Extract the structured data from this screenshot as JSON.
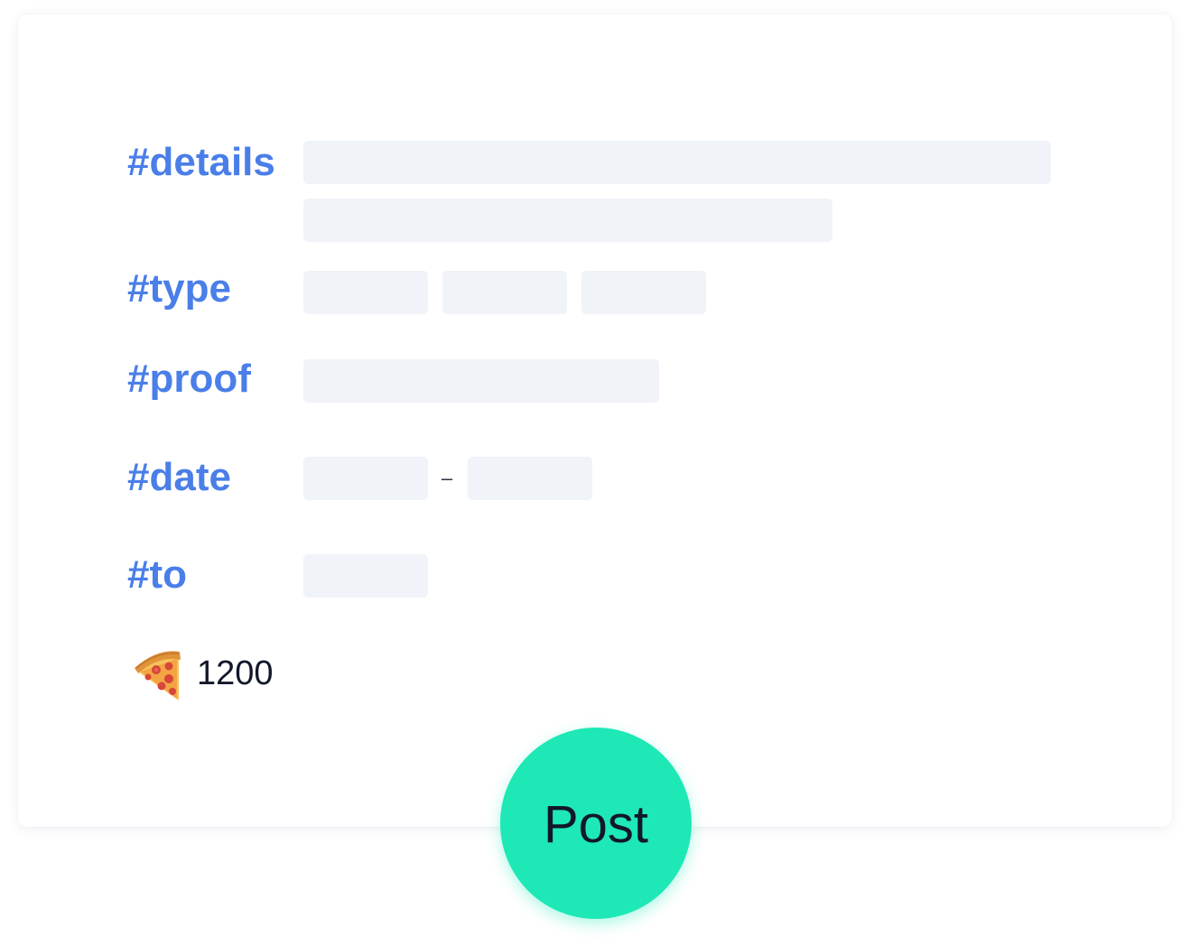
{
  "form": {
    "details_label": "#details",
    "type_label": "#type",
    "proof_label": "#proof",
    "date_label": "#date",
    "date_separator": "–",
    "to_label": "#to",
    "reward_icon": "pizza-icon",
    "reward_amount": "1200",
    "post_label": "Post"
  },
  "colors": {
    "label": "#4a7ee8",
    "field_placeholder": "#f0f3f8",
    "post_button": "#1ee8b6",
    "text_dark": "#12172a"
  }
}
